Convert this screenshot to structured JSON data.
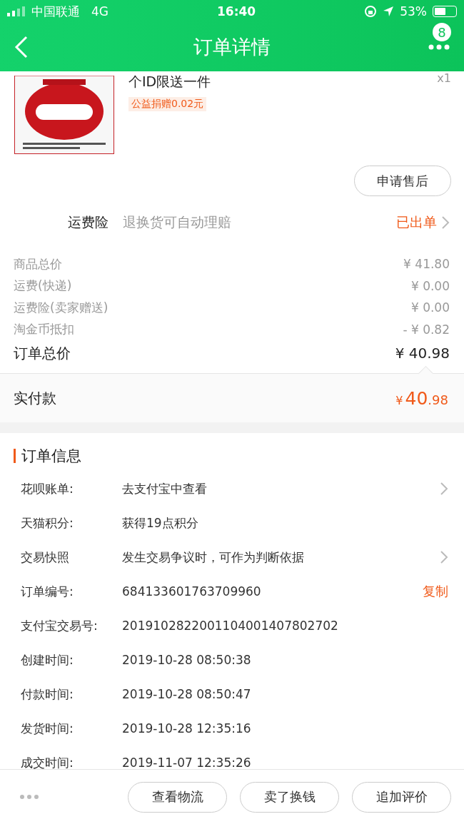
{
  "status_bar": {
    "carrier": "中国联通",
    "network": "4G",
    "time": "16:40",
    "battery": "53%"
  },
  "nav": {
    "title": "订单详情",
    "badge": "8"
  },
  "product": {
    "title": "个ID限送一件",
    "tag": "公益捐赠0.02元",
    "quantity": "x1",
    "action": "申请售后"
  },
  "insurance": {
    "label": "运费险",
    "description": "退换货可自动理赔",
    "status": "已出单"
  },
  "prices": [
    {
      "kind": "minor",
      "label": "商品总价",
      "value": "¥ 41.80"
    },
    {
      "kind": "minor",
      "label": "运费(快递)",
      "value": "¥ 0.00"
    },
    {
      "kind": "minor",
      "label": "运费险(卖家赠送)",
      "value": "¥ 0.00"
    },
    {
      "kind": "minor",
      "label": "淘金币抵扣",
      "value": "- ¥ 0.82"
    },
    {
      "kind": "total",
      "label": "订单总价",
      "value": "¥ 40.98"
    }
  ],
  "payment": {
    "label": "实付款",
    "currency": "¥",
    "integer": "40",
    "decimal": ".98"
  },
  "order_info": {
    "title": "订单信息",
    "rows": [
      {
        "label": "花呗账单:",
        "value": "去支付宝中查看",
        "chevron": true
      },
      {
        "label": "天猫积分:",
        "value": "获得19点积分",
        "chevron": false
      },
      {
        "label": "交易快照",
        "value": "发生交易争议时，可作为判断依据",
        "chevron": true
      },
      {
        "label": "订单编号:",
        "value": "684133601763709960",
        "action": "复制",
        "chevron": false
      },
      {
        "label": "支付宝交易号:",
        "value": "2019102822001104001407802702",
        "chevron": false
      },
      {
        "label": "创建时间:",
        "value": "2019-10-28 08:50:38",
        "chevron": false
      },
      {
        "label": "付款时间:",
        "value": "2019-10-28 08:50:47",
        "chevron": false
      },
      {
        "label": "发货时间:",
        "value": "2019-10-28 12:35:16",
        "chevron": false
      },
      {
        "label": "成交时间:",
        "value": "2019-11-07 12:35:26",
        "chevron": false
      }
    ]
  },
  "bottom_buttons": [
    "查看物流",
    "卖了换钱",
    "追加评价"
  ]
}
